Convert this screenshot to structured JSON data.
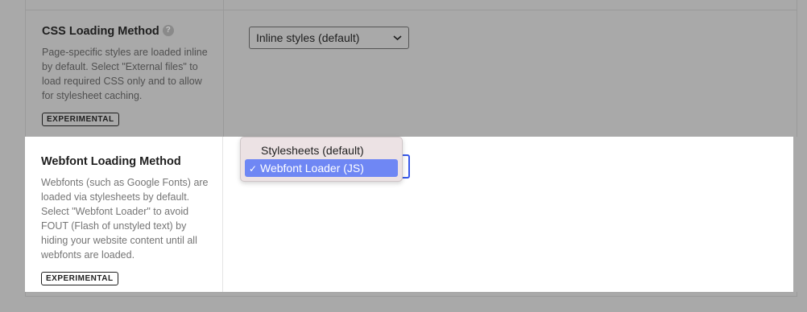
{
  "css_setting": {
    "title": "CSS Loading Method",
    "help_icon": "?",
    "description": "Page-specific styles are loaded inline by default. Select \"External files\" to load required CSS only and to allow for stylesheet caching.",
    "badge": "EXPERIMENTAL",
    "select_value": "Inline styles (default)"
  },
  "webfont_setting": {
    "title": "Webfont Loading Method",
    "description": "Webfonts (such as Google Fonts) are loaded via stylesheets by default. Select \"Webfont Loader\" to avoid FOUT (Flash of unstyled text) by hiding your website content until all webfonts are loaded.",
    "badge": "EXPERIMENTAL",
    "options": [
      {
        "label": "Stylesheets (default)",
        "selected": false
      },
      {
        "label": "Webfont Loader (JS)",
        "selected": true
      }
    ],
    "check_mark": "✓"
  },
  "colors": {
    "overlay": "#a9a9a9",
    "focus_blue": "#3858e9",
    "highlight": "#6f87f4"
  }
}
